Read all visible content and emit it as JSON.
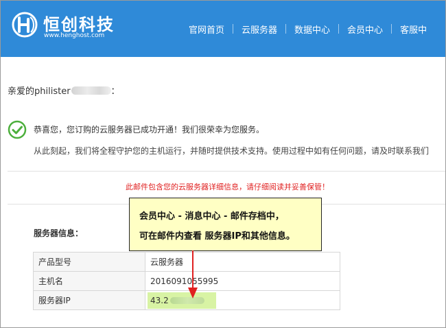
{
  "brand": {
    "title": "恒创科技",
    "url": "www.henghost.com",
    "color": "#2f8ad8"
  },
  "nav": [
    "官网首页",
    "云服务器",
    "数据中心",
    "会员中心",
    "客服中"
  ],
  "greeting": {
    "prefix": "亲爱的philister",
    "suffix": "："
  },
  "congrats": "恭喜您，您订购的云服务器已成功开通！我们很荣幸为您服务。",
  "support": "从此刻起，我们将全程守护您的主机运行，并随时提供技术支持。使用过程中如有任何问题，请及时联系我们",
  "notice": "此邮件包含您的云服务器详细信息，请仔细阅读并妥善保管！",
  "server_info_title": "服务器信息：",
  "server_table": [
    {
      "key": "产品型号",
      "value": "云服务器"
    },
    {
      "key": "主机名",
      "value": "2016091055995"
    },
    {
      "key": "服务器IP",
      "value": "43.2"
    }
  ],
  "tip": {
    "line1": "会员中心 - 消息中心 - 邮件存档中，",
    "line2": "可在邮件内查看 服务器IP和其他信息。"
  },
  "colors": {
    "notice": "#e02020",
    "check": "#4caf3c",
    "tip_bg": "#ffffc4",
    "ip_highlight": "#d8f3a4",
    "arrow": "#e02020"
  }
}
